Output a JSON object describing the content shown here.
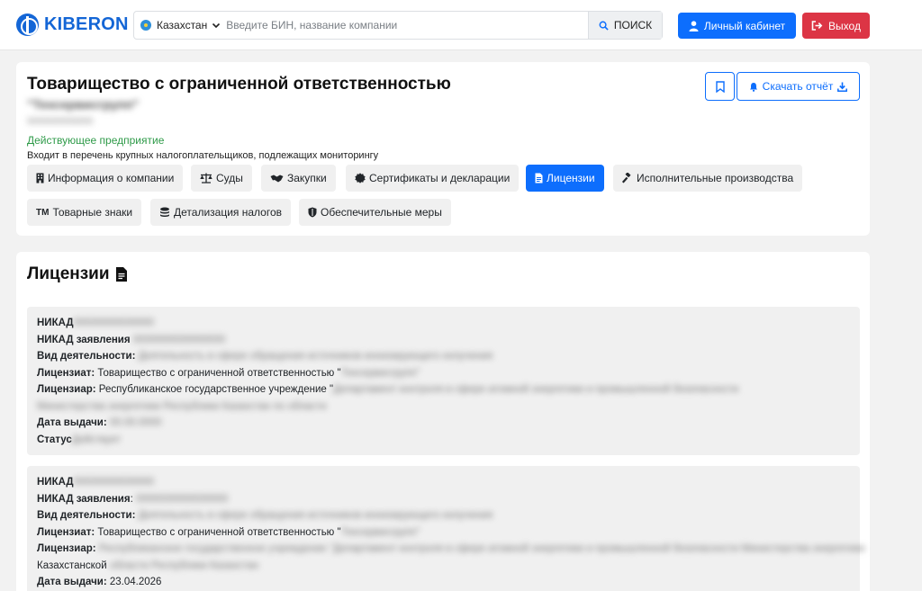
{
  "brand": {
    "logo_text": "KIBERON"
  },
  "search": {
    "country": "Казахстан",
    "placeholder": "Введите БИН, название компании",
    "button_label": "ПОИСК"
  },
  "header_buttons": {
    "cabinet": "Личный кабинет",
    "logout": "Выход"
  },
  "company": {
    "title": "Товарищество с ограниченной ответственностью",
    "name_blurred": "\"Техсервисгрупп\"",
    "id_blurred": "000000000000",
    "status": "Действующее предприятие",
    "tax_note": "Входит в перечень крупных налогоплательщиков, подлежащих мониторингу",
    "download_label": "Скачать отчёт",
    "tabs": [
      {
        "label": "Информация о компании",
        "icon": "building-icon"
      },
      {
        "label": "Суды",
        "icon": "scales-icon"
      },
      {
        "label": "Закупки",
        "icon": "handshake-icon"
      },
      {
        "label": "Сертификаты и декларации",
        "icon": "certificate-icon"
      },
      {
        "label": "Лицензии",
        "icon": "file-icon"
      },
      {
        "label": "Исполнительные производства",
        "icon": "gavel-icon"
      },
      {
        "label": "Товарные знаки",
        "icon": "trademark-icon"
      },
      {
        "label": "Детализация налогов",
        "icon": "coins-icon"
      },
      {
        "label": "Обеспечительные меры",
        "icon": "shield-icon"
      }
    ]
  },
  "licenses": {
    "title": "Лицензии",
    "labels": {
      "nikad": "НИКАД",
      "nikad_app": "НИКАД заявления",
      "activity": "Вид деятельности:",
      "licensee": "Лицензиат:",
      "licensor": "Лицензиар:",
      "issue_date": "Дата выдачи:",
      "status": "Статус"
    },
    "items": [
      {
        "nikad": "00000000000000",
        "nikad_app": "0000000000000000",
        "activity": "Деятельность в сфере обращения источников ионизирующего излучения",
        "licensee_text": "Товарищество с ограниченной ответственностью \"",
        "licensee_blur": "Техсервисгрупп\"",
        "licensor_text": "Республиканское государственное учреждение \"",
        "licensor_blur": "Департамент контроля в сфере атомной энергетики и промышленной безопасности Министерства энергетики Республики Казахстан по области",
        "issue_date": "00.00.0000",
        "status": "Действует"
      },
      {
        "nikad": "00000000000000",
        "nikad_app": "0000000000000000",
        "activity": "Деятельность в сфере обращения источников ионизирующего излучения",
        "licensee_text": "Товарищество с ограниченной ответственностью \"",
        "licensee_blur": "Техсервисгрупп\"",
        "licensor_text": "",
        "licensor_blur": "Республиканское государственное учреждение \"Департамент контроля в сфере атомной энергетики и промышленной безопасности Министерства энергетики",
        "licensor_cont": "Казахстанской",
        "licensor_cont_blur": "области Республики Казахстан",
        "issue_date": "23.04.2026"
      }
    ]
  },
  "colors": {
    "primary": "#0d6efd",
    "danger": "#dc3545",
    "success": "#2e9a48",
    "brand": "#1466d6"
  }
}
